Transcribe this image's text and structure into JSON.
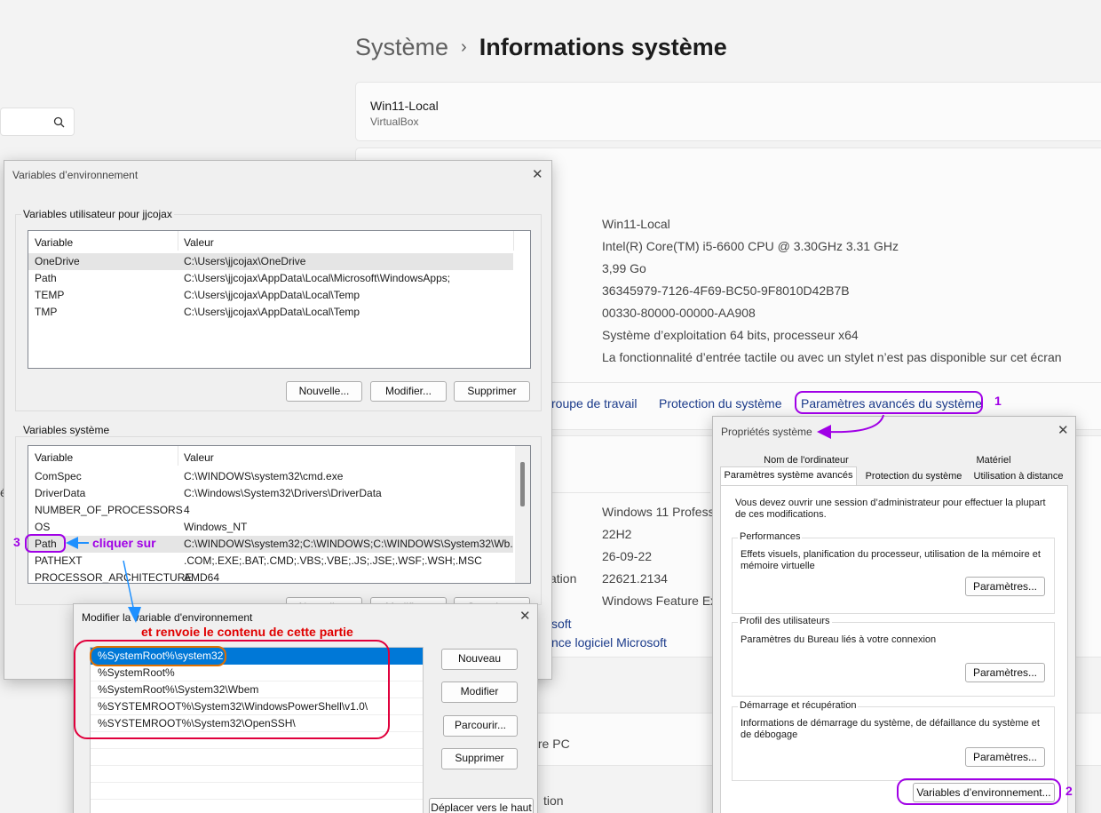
{
  "breadcrumb": {
    "parent": "Système",
    "separator": "›",
    "current": "Informations système"
  },
  "device": {
    "name": "Win11-Local",
    "model": "VirtualBox"
  },
  "specs": [
    "Win11-Local",
    "Intel(R) Core(TM) i5-6600 CPU @ 3.30GHz   3.31 GHz",
    "3,99 Go",
    "36345979-7126-4F69-BC50-9F8010D42B7B",
    "00330-80000-00000-AA908",
    "Système d’exploitation 64 bits, processeur x64",
    "La fonctionnalité d’entrée tactile ou avec un stylet n’est pas disponible sur cet écran"
  ],
  "related_links": {
    "workgroup": "roupe de travail",
    "protection": "Protection du système",
    "advanced": "Paramètres avancés du système"
  },
  "windows_specs": [
    "Windows 11 Professi",
    "22H2",
    "26-09-22",
    "22621.2134",
    "Windows Feature Ex"
  ],
  "partial_texts": {
    "s": "s",
    "ation": "ation",
    "soft": "soft",
    "licence": "nce logiciel Microsoft",
    "ce_pc": "tre PC",
    "tion": "tion",
    "e_char": "é"
  },
  "env_dialog": {
    "title": "Variables d’environnement",
    "user_group": "Variables utilisateur pour jjcojax",
    "col_variable": "Variable",
    "col_value": "Valeur",
    "user_vars": [
      {
        "name": "OneDrive",
        "value": "C:\\Users\\jjcojax\\OneDrive"
      },
      {
        "name": "Path",
        "value": "C:\\Users\\jjcojax\\AppData\\Local\\Microsoft\\WindowsApps;"
      },
      {
        "name": "TEMP",
        "value": "C:\\Users\\jjcojax\\AppData\\Local\\Temp"
      },
      {
        "name": "TMP",
        "value": "C:\\Users\\jjcojax\\AppData\\Local\\Temp"
      }
    ],
    "btn_new": "Nouvelle...",
    "btn_edit": "Modifier...",
    "btn_delete": "Supprimer",
    "sys_group": "Variables système",
    "sys_vars": [
      {
        "name": "ComSpec",
        "value": "C:\\WINDOWS\\system32\\cmd.exe"
      },
      {
        "name": "DriverData",
        "value": "C:\\Windows\\System32\\Drivers\\DriverData"
      },
      {
        "name": "NUMBER_OF_PROCESSORS",
        "value": "4"
      },
      {
        "name": "OS",
        "value": "Windows_NT"
      },
      {
        "name": "Path",
        "value": "C:\\WINDOWS\\system32;C:\\WINDOWS;C:\\WINDOWS\\System32\\Wb..."
      },
      {
        "name": "PATHEXT",
        "value": ".COM;.EXE;.BAT;.CMD;.VBS;.VBE;.JS;.JSE;.WSF;.WSH;.MSC"
      },
      {
        "name": "PROCESSOR_ARCHITECTURE",
        "value": "AMD64"
      }
    ],
    "partial_btns": [
      "Nouvelle...",
      "Modifier...",
      "Supprimer"
    ]
  },
  "edit_dialog": {
    "title": "Modifier la variable d'environnement",
    "entries": [
      "%SystemRoot%\\system32",
      "%SystemRoot%",
      "%SystemRoot%\\System32\\Wbem",
      "%SYSTEMROOT%\\System32\\WindowsPowerShell\\v1.0\\",
      "%SYSTEMROOT%\\System32\\OpenSSH\\"
    ],
    "btn_new": "Nouveau",
    "btn_edit": "Modifier",
    "btn_browse": "Parcourir...",
    "btn_delete": "Supprimer",
    "btn_move_up": "Déplacer vers le haut"
  },
  "sysprops": {
    "title": "Propriétés système",
    "tabs_top": [
      "Nom de l'ordinateur",
      "Matériel"
    ],
    "tabs_bottom": [
      "Paramètres système avancés",
      "Protection du système",
      "Utilisation à distance"
    ],
    "admin_note": "Vous devez ouvrir une session d’administrateur pour effectuer la plupart de ces modifications.",
    "perf_title": "Performances",
    "perf_desc": "Effets visuels, planification du processeur, utilisation de la mémoire et mémoire virtuelle",
    "profile_title": "Profil des utilisateurs",
    "profile_desc": "Paramètres du Bureau liés à votre connexion",
    "startup_title": "Démarrage et récupération",
    "startup_desc": "Informations de démarrage du système, de défaillance du système et de débogage",
    "btn_settings": "Paramètres...",
    "btn_env": "Variables d’environnement..."
  },
  "annotations": {
    "n1": "1",
    "n2": "2",
    "n3": "3",
    "click_on": "cliquer sur",
    "returns": "et renvoie le contenu de cette partie"
  },
  "colors": {
    "purple": "#a000e6",
    "blue": "#1e90ff",
    "red": "#e00000",
    "orange": "#e07000",
    "selection": "#0078d7"
  }
}
